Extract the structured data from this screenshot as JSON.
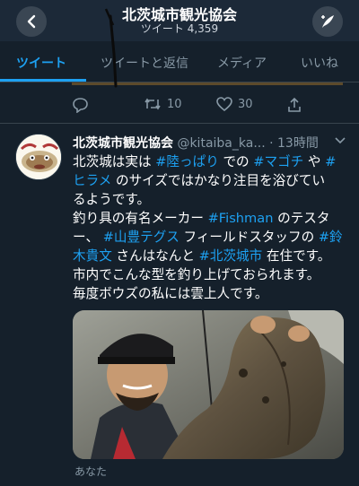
{
  "header": {
    "title": "北茨城市観光協会",
    "subtitle": "ツイート 4,359",
    "back_icon": "back-arrow-icon",
    "compose_icon": "compose-quill-icon"
  },
  "tabs": [
    {
      "label": "ツイート",
      "active": true
    },
    {
      "label": "ツイートと返信",
      "active": false
    },
    {
      "label": "メディア",
      "active": false
    },
    {
      "label": "いいね",
      "active": false
    }
  ],
  "prev_tweet_actions": {
    "reply_icon": "reply-icon",
    "retweet_count": "10",
    "like_count": "30",
    "share_icon": "share-icon"
  },
  "tweet": {
    "name": "北茨城市観光協会",
    "handle": "@kitaiba_ka...",
    "time": "· 13時間",
    "menu_icon": "chevron-down-icon",
    "lines": [
      [
        {
          "t": "北茨城は実は "
        },
        {
          "t": "#陸っぱり",
          "tag": true
        },
        {
          "t": " での "
        },
        {
          "t": "#マゴチ",
          "tag": true
        },
        {
          "t": " や "
        },
        {
          "t": "#",
          "tag": true
        }
      ],
      [
        {
          "t": "ヒラメ",
          "tag": true
        },
        {
          "t": " のサイズではかなり注目を浴びてい"
        }
      ],
      [
        {
          "t": "るようです。"
        }
      ],
      [
        {
          "t": "釣り具の有名メーカー "
        },
        {
          "t": "#Fishman",
          "tag": true
        },
        {
          "t": " のテスタ"
        }
      ],
      [
        {
          "t": "ー、 "
        },
        {
          "t": "#山豊テグス",
          "tag": true
        },
        {
          "t": " フィールドスタッフの "
        },
        {
          "t": "#鈴",
          "tag": true
        }
      ],
      [
        {
          "t": "木貴文",
          "tag": true
        },
        {
          "t": " さんはなんと "
        },
        {
          "t": "#北茨城市",
          "tag": true
        },
        {
          "t": " 在住です。"
        }
      ],
      [
        {
          "t": "市内でこんな型を釣り上げておられます。"
        }
      ],
      [
        {
          "t": "毎度ボウズの私には雲上人です。"
        }
      ]
    ],
    "media_caption": "あなた",
    "media_description_icon": "photo-fisherman-holding-flounder"
  },
  "colors": {
    "background": "#15202b",
    "header": "#1c2938",
    "accent": "#1da1f2",
    "muted": "#8899a6",
    "divider": "#38444d"
  }
}
